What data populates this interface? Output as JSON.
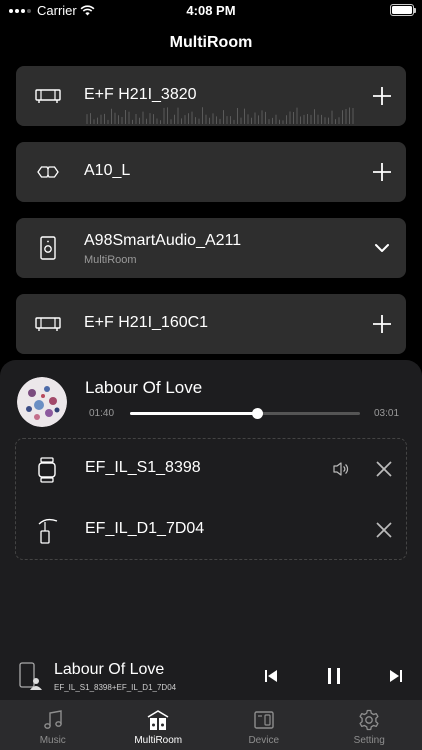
{
  "status_bar": {
    "carrier": "Carrier",
    "time": "4:08 PM"
  },
  "page": {
    "title": "MultiRoom"
  },
  "devices": [
    {
      "name": "E+F H21I_3820",
      "icon": "soundbar-icon",
      "action": "add-icon"
    },
    {
      "name": "A10_L",
      "icon": "stereo-pair-icon",
      "action": "add-icon"
    },
    {
      "name": "A98SmartAudio_A211",
      "subtitle": "MultiRoom",
      "icon": "speaker-icon",
      "action": "chevron-down-icon"
    },
    {
      "name": "E+F H21I_160C1",
      "icon": "soundbar-icon",
      "action": "add-icon"
    }
  ],
  "group_player": {
    "song": "Labour Of Love",
    "time_current": "01:40",
    "time_total": "03:01",
    "progress": 0.55,
    "members": [
      {
        "name": "EF_IL_S1_8398",
        "icon": "watch-speaker-icon",
        "has_volume": true
      },
      {
        "name": "EF_IL_D1_7D04",
        "icon": "lamp-speaker-icon",
        "has_volume": false
      }
    ]
  },
  "mini_player": {
    "song": "Labour Of Love",
    "devices": "EF_IL_S1_8398+EF_IL_D1_7D04"
  },
  "tabs": [
    {
      "label": "Music",
      "icon": "music-note-icon",
      "active": false
    },
    {
      "label": "MultiRoom",
      "icon": "multiroom-icon",
      "active": true
    },
    {
      "label": "Device",
      "icon": "device-icon",
      "active": false
    },
    {
      "label": "Setting",
      "icon": "gear-icon",
      "active": false
    }
  ]
}
